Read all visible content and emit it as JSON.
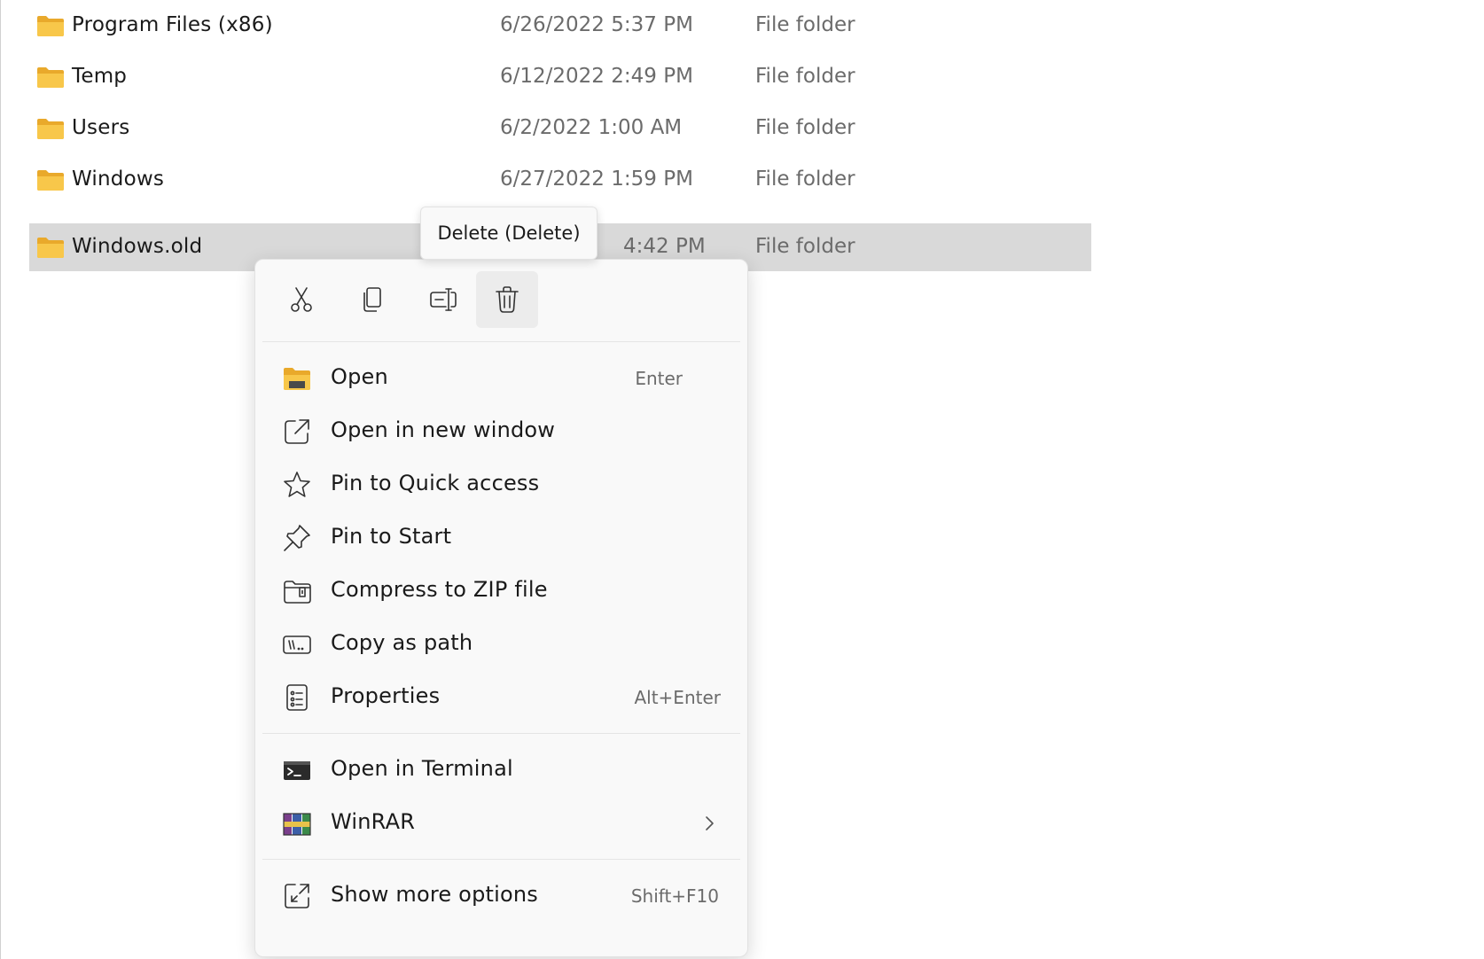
{
  "files": [
    {
      "name": "Program Files (x86)",
      "date": "6/26/2022 5:37 PM",
      "type": "File folder"
    },
    {
      "name": "Temp",
      "date": "6/12/2022 2:49 PM",
      "type": "File folder"
    },
    {
      "name": "Users",
      "date": "6/2/2022 1:00 AM",
      "type": "File folder"
    },
    {
      "name": "Windows",
      "date": "6/27/2022 1:59 PM",
      "type": "File folder"
    },
    {
      "name": "Windows.old",
      "date": "4:42 PM",
      "type": "File folder"
    }
  ],
  "selected_file_index": 4,
  "tooltip": {
    "text": "Delete (Delete)"
  },
  "context_menu": {
    "toolbar": [
      {
        "name": "cut",
        "icon": "scissors-icon"
      },
      {
        "name": "copy",
        "icon": "copy-icon"
      },
      {
        "name": "rename",
        "icon": "rename-icon"
      },
      {
        "name": "delete",
        "icon": "trash-icon"
      }
    ],
    "items": [
      {
        "label": "Open",
        "shortcut": "Enter",
        "icon": "folder-open-icon"
      },
      {
        "label": "Open in new window",
        "shortcut": "",
        "icon": "open-new-window-icon"
      },
      {
        "label": "Pin to Quick access",
        "shortcut": "",
        "icon": "star-icon"
      },
      {
        "label": "Pin to Start",
        "shortcut": "",
        "icon": "pin-icon"
      },
      {
        "label": "Compress to ZIP file",
        "shortcut": "",
        "icon": "zip-folder-icon"
      },
      {
        "label": "Copy as path",
        "shortcut": "",
        "icon": "copy-path-icon"
      },
      {
        "label": "Properties",
        "shortcut": "Alt+Enter",
        "icon": "properties-icon"
      },
      {
        "label": "Open in Terminal",
        "shortcut": "",
        "icon": "terminal-icon"
      },
      {
        "label": "WinRAR",
        "shortcut": "",
        "icon": "winrar-icon",
        "submenu": true
      },
      {
        "label": "Show more options",
        "shortcut": "Shift+F10",
        "icon": "more-options-icon"
      }
    ]
  },
  "colors": {
    "folder_yellow": "#f8c74a",
    "folder_yellow_dark": "#e9a92b",
    "selection_bg": "#d9d9d9",
    "secondary_text": "#6b6b6b"
  }
}
